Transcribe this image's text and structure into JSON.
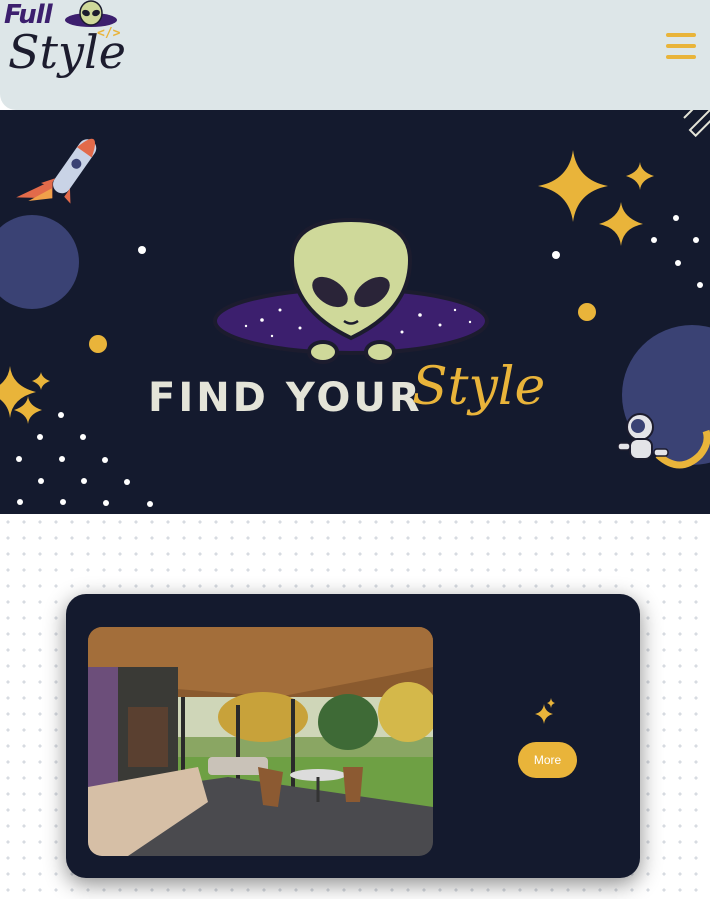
{
  "brand": {
    "logo_word_1": "Full",
    "logo_word_2": "Style",
    "logo_code_tag": "</>",
    "accent_color": "#e9b43a",
    "brand_purple": "#3c1f6e",
    "dark_background": "#141a2e"
  },
  "header": {
    "menu_icon": "hamburger-menu-icon",
    "background": "#dde6e8"
  },
  "hero": {
    "title": "FIND YOUR",
    "title_accent": "Style",
    "icons": [
      "rocket-icon",
      "alien-icon",
      "astronaut-icon",
      "sparkle-star-icon"
    ]
  },
  "card": {
    "image_description_icon": "porch-photo",
    "sparkle_icon": "sparkle-icon",
    "button_label": "More"
  }
}
